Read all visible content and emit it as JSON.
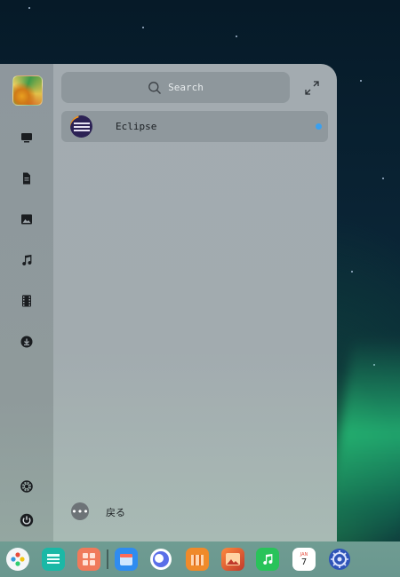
{
  "search": {
    "placeholder": "Search"
  },
  "apps": [
    {
      "label": "Eclipse",
      "new": true
    }
  ],
  "footer": {
    "back_label": "戻る",
    "more_symbol": "•••"
  },
  "rail": {
    "icons": [
      "desktop-icon",
      "document-icon",
      "image-icon",
      "music-icon",
      "video-icon",
      "download-icon",
      "settings-icon",
      "power-icon"
    ]
  },
  "dock": {
    "icons": [
      "launcher-icon",
      "files-icon",
      "app-store-icon",
      "store-icon",
      "browser-icon",
      "package-icon",
      "photos-icon",
      "music-player-icon",
      "calendar-icon",
      "settings-icon"
    ],
    "calendar": {
      "month": "JAN",
      "day": "7"
    }
  },
  "colors": {
    "accent": "#3aa0f0",
    "eclipse_orange": "#f59a1e",
    "eclipse_purple": "#2c2255"
  }
}
